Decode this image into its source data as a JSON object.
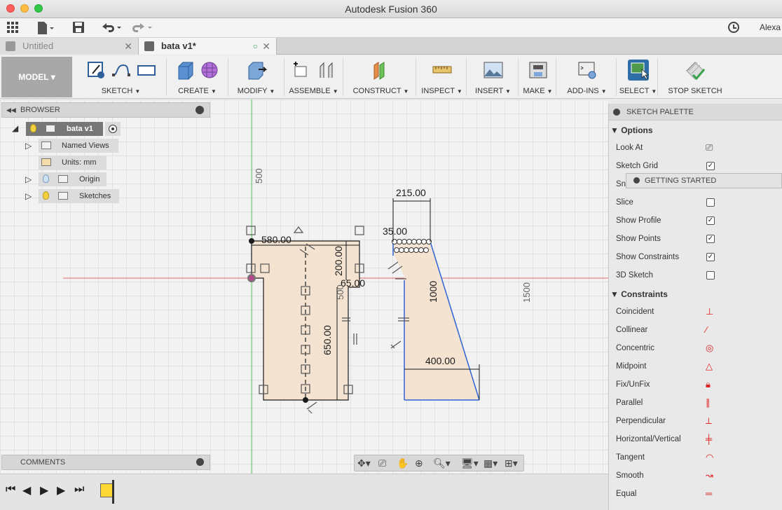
{
  "window": {
    "title": "Autodesk Fusion 360"
  },
  "quickbar": {
    "user": "Alexa"
  },
  "tabs": [
    {
      "label": "Untitled"
    },
    {
      "label": "bata v1*"
    }
  ],
  "ribbon": {
    "workspace": "MODEL ▾",
    "groups": [
      {
        "label": "SKETCH"
      },
      {
        "label": "CREATE"
      },
      {
        "label": "MODIFY"
      },
      {
        "label": "ASSEMBLE"
      },
      {
        "label": "CONSTRUCT"
      },
      {
        "label": "INSPECT"
      },
      {
        "label": "INSERT"
      },
      {
        "label": "MAKE"
      },
      {
        "label": "ADD-INS"
      },
      {
        "label": "SELECT"
      },
      {
        "label": "STOP SKETCH"
      }
    ]
  },
  "browser": {
    "title": "BROWSER",
    "root": "bata v1",
    "items": [
      {
        "label": "Named Views"
      },
      {
        "label": "Units: mm"
      },
      {
        "label": "Origin"
      },
      {
        "label": "Sketches"
      }
    ]
  },
  "comments": {
    "title": "COMMENTS"
  },
  "sketch": {
    "dimensions": {
      "d580": "580.00",
      "d200": "200.00",
      "d65": "65.00",
      "d650": "650.00",
      "d215": "215.00",
      "d35": "35.00",
      "d1000": "1000",
      "d400": "400.00",
      "d500": "500",
      "d500b": "500",
      "d1500": "1500"
    }
  },
  "palette": {
    "title": "SKETCH PALETTE",
    "options_title": "Options",
    "options": [
      {
        "label": "Look At",
        "type": "button"
      },
      {
        "label": "Sketch Grid",
        "checked": true
      },
      {
        "label": "Sna",
        "checked": true
      },
      {
        "label": "Slice",
        "checked": false
      },
      {
        "label": "Show Profile",
        "checked": true
      },
      {
        "label": "Show Points",
        "checked": true
      },
      {
        "label": "Show Constraints",
        "checked": true
      },
      {
        "label": "3D Sketch",
        "checked": false
      }
    ],
    "constraints_title": "Constraints",
    "constraints": [
      {
        "label": "Coincident",
        "icon": "coincident-icon"
      },
      {
        "label": "Collinear",
        "icon": "collinear-icon"
      },
      {
        "label": "Concentric",
        "icon": "concentric-icon"
      },
      {
        "label": "Midpoint",
        "icon": "midpoint-icon"
      },
      {
        "label": "Fix/UnFix",
        "icon": "lock-icon"
      },
      {
        "label": "Parallel",
        "icon": "parallel-icon"
      },
      {
        "label": "Perpendicular",
        "icon": "perpendicular-icon"
      },
      {
        "label": "Horizontal/Vertical",
        "icon": "horizontal-vertical-icon"
      },
      {
        "label": "Tangent",
        "icon": "tangent-icon"
      },
      {
        "label": "Smooth",
        "icon": "smooth-icon"
      },
      {
        "label": "Equal",
        "icon": "equal-icon"
      }
    ]
  },
  "getting_started": {
    "label": "GETTING STARTED"
  },
  "colors": {
    "sketch_line": "#1a1a1a",
    "profile_fill": "#f4e3d0",
    "selected_line": "#2f63d6",
    "x_axis": "#e36a6a",
    "y_axis": "#5ec36a",
    "select_active": "#2e6ea6"
  }
}
